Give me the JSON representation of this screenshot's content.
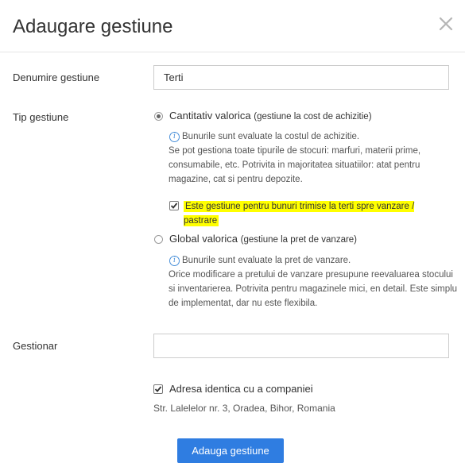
{
  "header": {
    "title": "Adaugare gestiune",
    "close_icon": "close-icon"
  },
  "form": {
    "name": {
      "label": "Denumire gestiune",
      "value": "Terti"
    },
    "type": {
      "label": "Tip gestiune",
      "options": [
        {
          "label_main": "Cantitativ valorica",
          "label_small": "(gestiune la cost de achizitie)",
          "selected": true,
          "info_first_line": "Bunurile sunt evaluate la costul de achizitie.",
          "info_rest": "Se pot gestiona toate tipurile de stocuri: marfuri, materii prime, consumabile, etc. Potrivita in majoritatea situatiilor: atat pentru magazine, cat si pentru depozite.",
          "third_party_checkbox": {
            "label": "Este gestiune pentru bunuri trimise la terti spre vanzare / pastrare",
            "checked": true
          }
        },
        {
          "label_main": "Global valorica",
          "label_small": "(gestiune la pret de vanzare)",
          "selected": false,
          "info_first_line": "Bunurile sunt evaluate la pret de vanzare.",
          "info_rest": "Orice modificare a pretului de vanzare presupune reevaluarea stocului si inventarierea. Potrivita pentru magazinele mici, en detail. Este simplu de implementat, dar nu este flexibila."
        }
      ]
    },
    "manager": {
      "label": "Gestionar",
      "value": ""
    },
    "address": {
      "checkbox_label": "Adresa identica cu a companiei",
      "checked": true,
      "text": "Str. Lalelelor nr. 3, Oradea, Bihor, Romania"
    },
    "submit_label": "Adauga gestiune"
  },
  "colors": {
    "primary_button": "#2f7de1",
    "highlight": "#ffff00",
    "info_icon": "#4a90d9"
  }
}
